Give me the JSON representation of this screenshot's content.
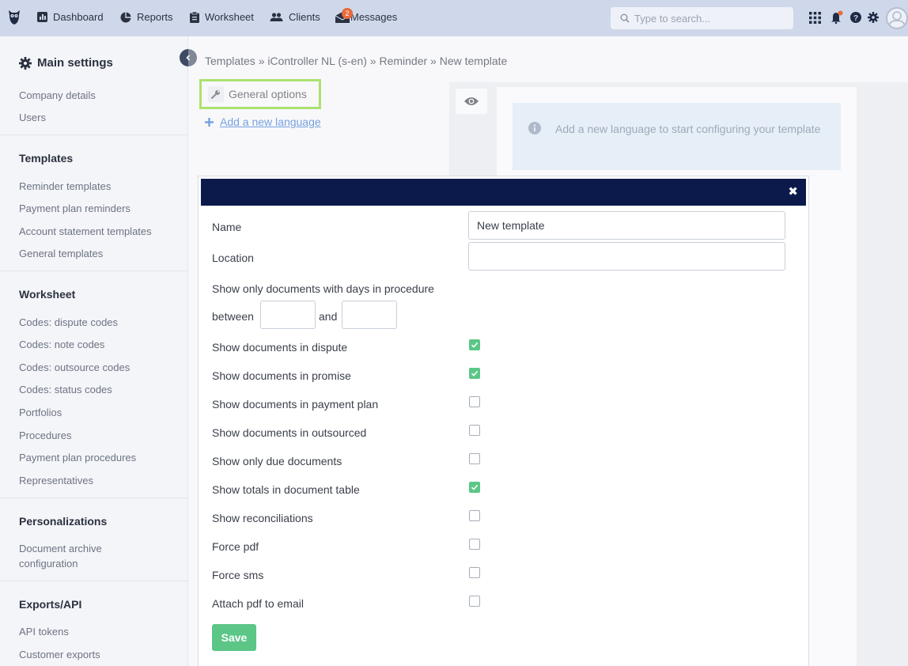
{
  "topbar": {
    "nav": [
      {
        "label": "Dashboard",
        "icon": "dashboard-icon"
      },
      {
        "label": "Reports",
        "icon": "pie-chart-icon"
      },
      {
        "label": "Worksheet",
        "icon": "clipboard-icon"
      },
      {
        "label": "Clients",
        "icon": "users-icon"
      },
      {
        "label": "Messages",
        "icon": "mail-icon",
        "badge": "2"
      }
    ],
    "search_placeholder": "Type to search..."
  },
  "sidebar": {
    "main_title": "Main settings",
    "sections": [
      {
        "links": [
          "Company details",
          "Users"
        ]
      },
      {
        "title": "Templates",
        "links": [
          "Reminder templates",
          "Payment plan reminders",
          "Account statement templates",
          "General templates"
        ]
      },
      {
        "title": "Worksheet",
        "links": [
          "Codes: dispute codes",
          "Codes: note codes",
          "Codes: outsource codes",
          "Codes: status codes",
          "Portfolios",
          "Procedures",
          "Payment plan procedures",
          "Representatives"
        ]
      },
      {
        "title": "Personalizations",
        "links": [
          "Document archive configuration"
        ]
      },
      {
        "title": "Exports/API",
        "links": [
          "API tokens",
          "Customer exports"
        ]
      }
    ]
  },
  "main": {
    "breadcrumb": "Templates » iController NL (s-en) » Reminder » New template",
    "general_options": "General options",
    "add_language": "Add a new language",
    "info_message": "Add a new language to start configuring your template"
  },
  "modal": {
    "name_label": "Name",
    "name_value": "New template",
    "location_label": "Location",
    "location_value": "",
    "days_label": "Show only documents with days in procedure",
    "between_label": "between",
    "and_label": "and",
    "options": [
      {
        "label": "Show documents in dispute",
        "checked": true
      },
      {
        "label": "Show documents in promise",
        "checked": true
      },
      {
        "label": "Show documents in payment plan",
        "checked": false
      },
      {
        "label": "Show documents in outsourced",
        "checked": false
      },
      {
        "label": "Show only due documents",
        "checked": false
      },
      {
        "label": "Show totals in document table",
        "checked": true
      },
      {
        "label": "Show reconciliations",
        "checked": false
      },
      {
        "label": "Force pdf",
        "checked": false
      },
      {
        "label": "Force sms",
        "checked": false
      },
      {
        "label": "Attach pdf to email",
        "checked": false
      }
    ],
    "save_label": "Save",
    "close_glyph": "✖"
  },
  "colors": {
    "topbar": "#cfd8ea",
    "modal_header": "#0c1a4b",
    "accent_green": "#5cc687",
    "highlight": "#7ed321",
    "link": "#2d6fd0"
  }
}
